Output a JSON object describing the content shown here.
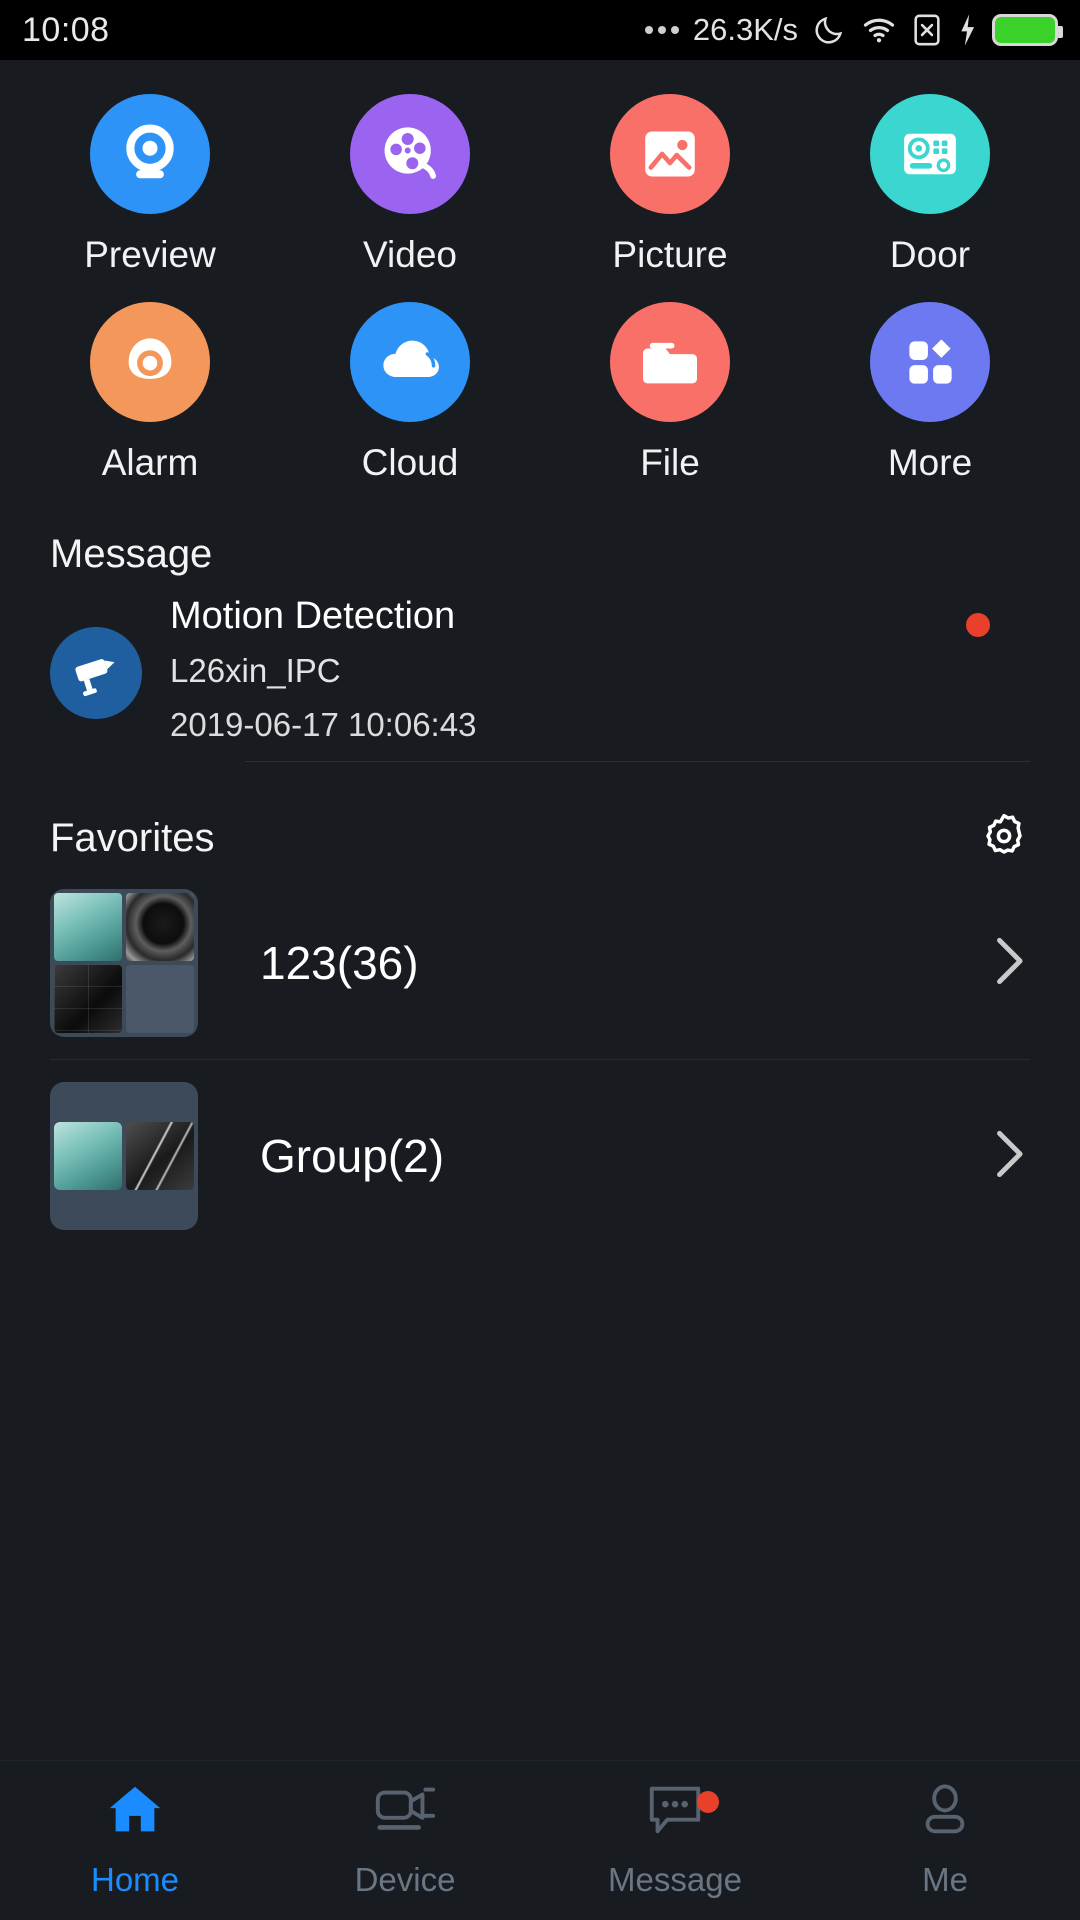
{
  "statusbar": {
    "time": "10:08",
    "network_speed": "26.3K/s",
    "icons": [
      "dnd-moon-icon",
      "wifi-icon",
      "sim-card-x-icon",
      "charging-bolt-icon",
      "battery-icon"
    ],
    "battery_color": "#39d12a"
  },
  "shortcuts": [
    {
      "label": "Preview",
      "icon": "webcam-icon",
      "color": "#2e93f7"
    },
    {
      "label": "Video",
      "icon": "film-reel-icon",
      "color": "#9a64f0"
    },
    {
      "label": "Picture",
      "icon": "image-icon",
      "color": "#f97068"
    },
    {
      "label": "Door",
      "icon": "intercom-icon",
      "color": "#3bd6cf"
    },
    {
      "label": "Alarm",
      "icon": "alarm-bell-icon",
      "color": "#f4975a"
    },
    {
      "label": "Cloud",
      "icon": "cloud-icon",
      "color": "#2e93f7"
    },
    {
      "label": "File",
      "icon": "folder-icon",
      "color": "#f97068"
    },
    {
      "label": "More",
      "icon": "grid-dots-icon",
      "color": "#6c79f0"
    }
  ],
  "message_section": {
    "title": "Message",
    "item": {
      "title": "Motion Detection",
      "device": "L26xin_IPC",
      "timestamp": "2019-06-17 10:06:43",
      "unread": true,
      "unread_color": "#e8402a",
      "icon": "cctv-camera-icon"
    }
  },
  "favorites_section": {
    "title": "Favorites",
    "settings_icon": "gear-icon",
    "items": [
      {
        "name": "123(36)",
        "thumbs": 4,
        "chevron": "chevron-right-icon"
      },
      {
        "name": "Group(2)",
        "thumbs": 2,
        "chevron": "chevron-right-icon"
      }
    ]
  },
  "bottom_nav": {
    "active_color": "#1a8cff",
    "inactive_color": "#6b7684",
    "items": [
      {
        "label": "Home",
        "icon": "home-icon",
        "active": true,
        "badge": false
      },
      {
        "label": "Device",
        "icon": "camcorder-icon",
        "active": false,
        "badge": false
      },
      {
        "label": "Message",
        "icon": "chat-bubble-icon",
        "active": false,
        "badge": true
      },
      {
        "label": "Me",
        "icon": "person-icon",
        "active": false,
        "badge": false
      }
    ]
  }
}
